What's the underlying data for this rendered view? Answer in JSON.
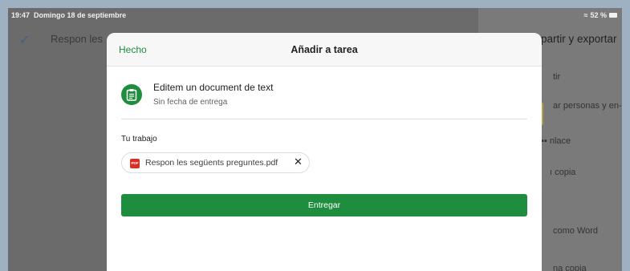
{
  "status_bar": {
    "time": "19:47",
    "date": "Domingo 18 de septiembre",
    "wifi_icon": "wifi-icon",
    "battery": "52 %"
  },
  "background": {
    "task_text": "Respon les",
    "side_title": "partir y exportar",
    "side_items": [
      "tir",
      "ar personas y en-",
      "▪▪ nlace",
      "ı copia",
      "como Word",
      "na copia"
    ]
  },
  "modal": {
    "done_label": "Hecho",
    "title": "Añadir a tarea",
    "assignment_title": "Editem un document de text",
    "assignment_subtitle": "Sin fecha de entrega",
    "work_label": "Tu trabajo",
    "file": {
      "name": "Respon les següents preguntes.pdf",
      "type_label": "PDF",
      "remove_icon": "close-icon"
    },
    "submit_label": "Entregar"
  },
  "colors": {
    "accent_green": "#1e8e3e",
    "pdf_red": "#d93025"
  }
}
